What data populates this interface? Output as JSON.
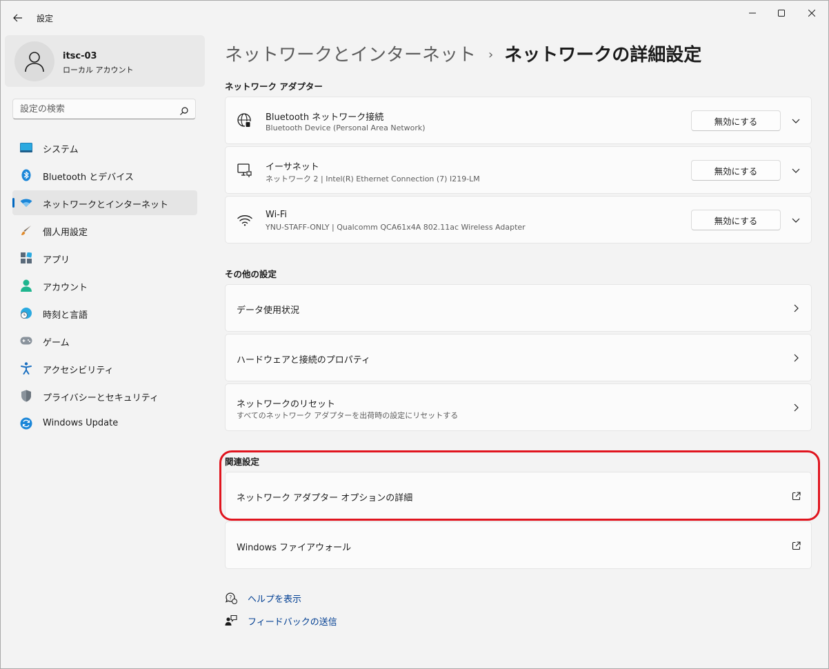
{
  "window": {
    "title": "設定"
  },
  "profile": {
    "name": "itsc-03",
    "account_type": "ローカル アカウント"
  },
  "search": {
    "placeholder": "設定の検索"
  },
  "sidebar": {
    "items": [
      {
        "label": "システム",
        "icon": "system-icon",
        "active": false
      },
      {
        "label": "Bluetooth とデバイス",
        "icon": "bluetooth-icon",
        "active": false
      },
      {
        "label": "ネットワークとインターネット",
        "icon": "wifi-icon",
        "active": true
      },
      {
        "label": "個人用設定",
        "icon": "brush-icon",
        "active": false
      },
      {
        "label": "アプリ",
        "icon": "apps-icon",
        "active": false
      },
      {
        "label": "アカウント",
        "icon": "account-icon",
        "active": false
      },
      {
        "label": "時刻と言語",
        "icon": "time-language-icon",
        "active": false
      },
      {
        "label": "ゲーム",
        "icon": "gamepad-icon",
        "active": false
      },
      {
        "label": "アクセシビリティ",
        "icon": "accessibility-icon",
        "active": false
      },
      {
        "label": "プライバシーとセキュリティ",
        "icon": "shield-icon",
        "active": false
      },
      {
        "label": "Windows Update",
        "icon": "update-icon",
        "active": false
      }
    ]
  },
  "breadcrumb": {
    "parent": "ネットワークとインターネット",
    "separator": "›",
    "current": "ネットワークの詳細設定"
  },
  "adapters": {
    "section_title": "ネットワーク アダプター",
    "disable_label": "無効にする",
    "items": [
      {
        "name": "Bluetooth ネットワーク接続",
        "description": "Bluetooth Device (Personal Area Network)",
        "icon": "bluetooth-network-icon"
      },
      {
        "name": "イーサネット",
        "description": "ネットワーク 2 | Intel(R) Ethernet Connection (7) I219-LM",
        "icon": "ethernet-icon"
      },
      {
        "name": "Wi-Fi",
        "description": "YNU-STAFF-ONLY | Qualcomm QCA61x4A 802.11ac Wireless Adapter",
        "icon": "wifi-icon"
      }
    ]
  },
  "other_settings": {
    "section_title": "その他の設定",
    "items": [
      {
        "title": "データ使用状況",
        "subtitle": ""
      },
      {
        "title": "ハードウェアと接続のプロパティ",
        "subtitle": ""
      },
      {
        "title": "ネットワークのリセット",
        "subtitle": "すべてのネットワーク アダプターを出荷時の設定にリセットする"
      }
    ]
  },
  "related_settings": {
    "section_title": "関連設定",
    "items": [
      {
        "title": "ネットワーク アダプター オプションの詳細",
        "icon": "external-link-icon"
      },
      {
        "title": "Windows ファイアウォール",
        "icon": "external-link-icon"
      }
    ]
  },
  "help": {
    "help_label": "ヘルプを表示",
    "feedback_label": "フィードバックの送信"
  },
  "colors": {
    "accent": "#0067c0",
    "highlight_annotation": "#e0141e",
    "link": "#003e92"
  }
}
